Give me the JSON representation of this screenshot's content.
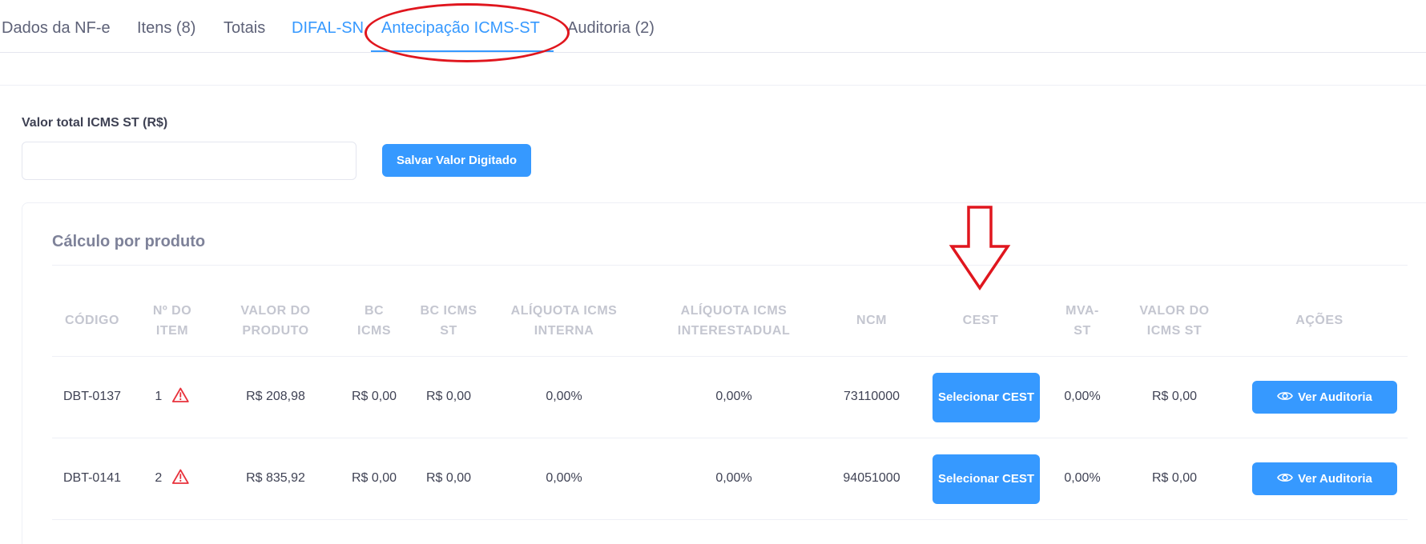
{
  "tabs": [
    {
      "label": "Dados da NF-e"
    },
    {
      "label": "Itens (8)"
    },
    {
      "label": "Totais"
    },
    {
      "label": "DIFAL-SN"
    },
    {
      "label": "Antecipação ICMS-ST"
    },
    {
      "label": "Auditoria (2)"
    }
  ],
  "form": {
    "label": "Valor total ICMS ST (R$)",
    "value": "",
    "save_label": "Salvar Valor Digitado"
  },
  "card": {
    "title": "Cálculo por produto"
  },
  "table": {
    "headers": [
      [
        "CÓDIGO"
      ],
      [
        "Nº DO",
        "ITEM"
      ],
      [
        "VALOR DO",
        "PRODUTO"
      ],
      [
        "BC",
        "ICMS"
      ],
      [
        "BC ICMS",
        "ST"
      ],
      [
        "ALÍQUOTA ICMS",
        "INTERNA"
      ],
      [
        "ALÍQUOTA ICMS",
        "INTERESTADUAL"
      ],
      [
        "NCM"
      ],
      [
        "CEST"
      ],
      [
        "MVA-",
        "ST"
      ],
      [
        "VALOR DO",
        "ICMS ST"
      ],
      [
        "AÇÕES"
      ]
    ],
    "rows": [
      {
        "codigo": "DBT-0137",
        "item": "1",
        "valor_produto": "R$ 208,98",
        "bc_icms": "R$ 0,00",
        "bc_icms_st": "R$ 0,00",
        "aliq_interna": "0,00%",
        "aliq_interestadual": "0,00%",
        "ncm": "73110000",
        "cest_button": "Selecionar CEST",
        "mva_st": "0,00%",
        "valor_icms_st": "R$ 0,00",
        "action_label": "Ver Auditoria"
      },
      {
        "codigo": "DBT-0141",
        "item": "2",
        "valor_produto": "R$ 835,92",
        "bc_icms": "R$ 0,00",
        "bc_icms_st": "R$ 0,00",
        "aliq_interna": "0,00%",
        "aliq_interestadual": "0,00%",
        "ncm": "94051000",
        "cest_button": "Selecionar CEST",
        "mva_st": "0,00%",
        "valor_icms_st": "R$ 0,00",
        "action_label": "Ver Auditoria"
      }
    ]
  },
  "colors": {
    "accent": "#3699ff",
    "annotation_red": "#e0161e",
    "warning": "#e8323c"
  },
  "icons": {
    "row_warning": "warning-triangle-icon",
    "action": "eye-icon",
    "annotation": "down-arrow-annotation"
  }
}
